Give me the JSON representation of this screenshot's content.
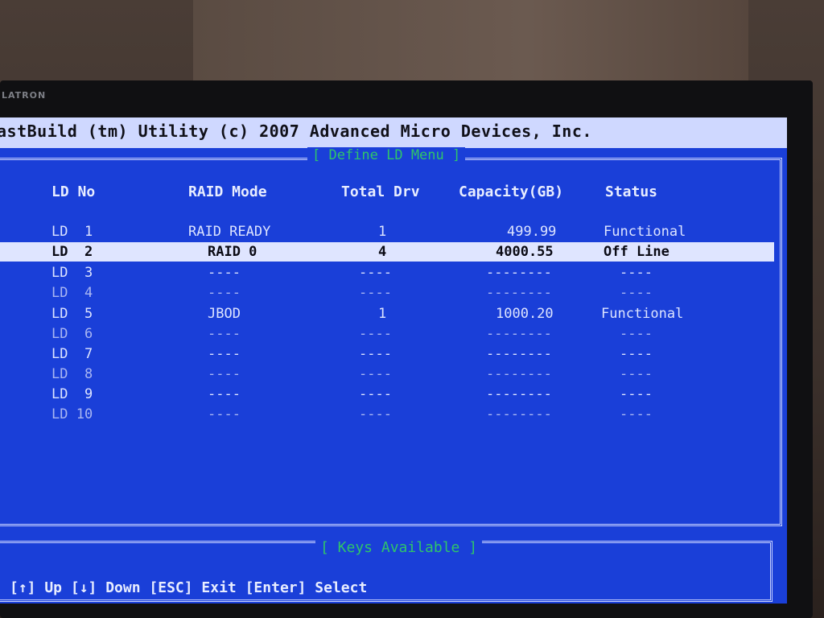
{
  "title": "astBuild (tm) Utility (c) 2007 Advanced Micro Devices, Inc.",
  "brand": "LATRON",
  "menu_title": "[ Define LD Menu ]",
  "columns": {
    "ld_no": "LD No",
    "raid_mode": "RAID Mode",
    "total_drv": "Total Drv",
    "capacity": "Capacity(GB)",
    "status": "Status"
  },
  "rows": [
    {
      "ld": "LD  1",
      "mode": "RAID READY",
      "drv": "1",
      "cap": "499.99",
      "status": "Functional"
    },
    {
      "ld": "LD  2",
      "mode": "RAID 0",
      "drv": "4",
      "cap": "4000.55",
      "status": "Off Line"
    },
    {
      "ld": "LD  3",
      "mode": "----",
      "drv": "----",
      "cap": "--------",
      "status": "----"
    },
    {
      "ld": "LD  4",
      "mode": "----",
      "drv": "----",
      "cap": "--------",
      "status": "----"
    },
    {
      "ld": "LD  5",
      "mode": "JBOD",
      "drv": "1",
      "cap": "1000.20",
      "status": "Functional"
    },
    {
      "ld": "LD  6",
      "mode": "----",
      "drv": "----",
      "cap": "--------",
      "status": "----"
    },
    {
      "ld": "LD  7",
      "mode": "----",
      "drv": "----",
      "cap": "--------",
      "status": "----"
    },
    {
      "ld": "LD  8",
      "mode": "----",
      "drv": "----",
      "cap": "--------",
      "status": "----"
    },
    {
      "ld": "LD  9",
      "mode": "----",
      "drv": "----",
      "cap": "--------",
      "status": "----"
    },
    {
      "ld": "LD 10",
      "mode": "----",
      "drv": "----",
      "cap": "--------",
      "status": "----"
    }
  ],
  "selected_row": "LD  2",
  "keys_title": "[ Keys Available ]",
  "keys_text": "[↑] Up [↓] Down [ESC] Exit [Enter] Select",
  "colors": {
    "screen_bg": "#1a3fd8",
    "title_bar_bg": "#cfd8ff",
    "menu_title": "#2fc46a",
    "selection_bg": "#dfe5ff"
  }
}
